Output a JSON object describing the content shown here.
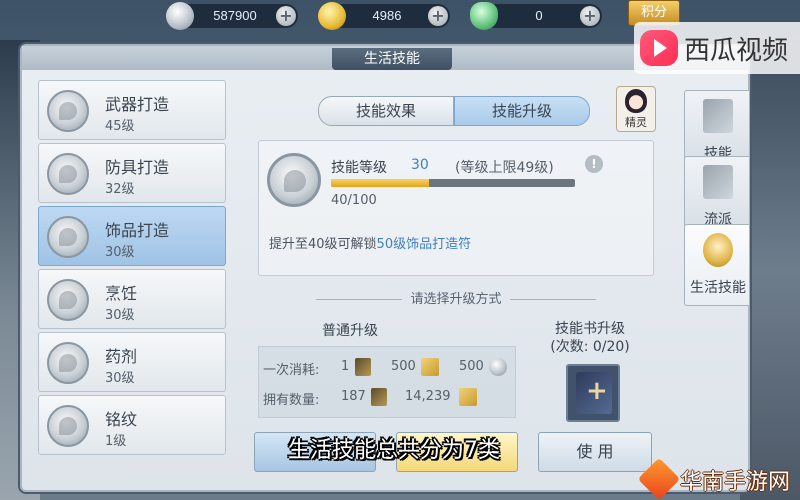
{
  "currencies": [
    {
      "icon": "silver-coin-icon",
      "value": "587900"
    },
    {
      "icon": "gold-ingot-icon",
      "value": "4986"
    },
    {
      "icon": "jade-icon",
      "value": "0"
    }
  ],
  "score_button": "积分",
  "watermark_top": "西瓜视频",
  "panel_title": "生活技能",
  "skills": [
    {
      "name": "武器打造",
      "level": "45级"
    },
    {
      "name": "防具打造",
      "level": "32级"
    },
    {
      "name": "饰品打造",
      "level": "30级"
    },
    {
      "name": "烹饪",
      "level": "30级"
    },
    {
      "name": "药剂",
      "level": "30级"
    },
    {
      "name": "铭纹",
      "level": "1级"
    }
  ],
  "tabs": [
    "技能效果",
    "技能升级"
  ],
  "spirit_label": "精灵",
  "skill_detail": {
    "level_label": "技能等级",
    "level_value": "30",
    "level_cap": "(等级上限49级)",
    "progress_text": "40/100",
    "progress_fraction": 0.4,
    "unlock_prefix": "提升至40级可解锁",
    "unlock_highlight": "50级饰品打造符"
  },
  "divider_text": "请选择升级方式",
  "normal_upgrade": {
    "title": "普通升级",
    "cost_label": "一次消耗:",
    "cost_book": "1",
    "cost_note": "500",
    "cost_coin": "500",
    "own_label": "拥有数量:",
    "own_book": "187",
    "own_note": "14,239"
  },
  "book_upgrade": {
    "title": "技能书升级",
    "count": "(次数: 0/20)"
  },
  "buttons": {
    "use": "使 用"
  },
  "caption": "生活技能总共分为7类",
  "side_tabs": [
    "技能",
    "流派",
    "生活技能"
  ],
  "watermark_bottom": "华南手游网",
  "colors": {
    "accent_blue": "#3f7fc4",
    "progress_gold": "#e3a51c",
    "active_tab": "#a9cae9"
  }
}
